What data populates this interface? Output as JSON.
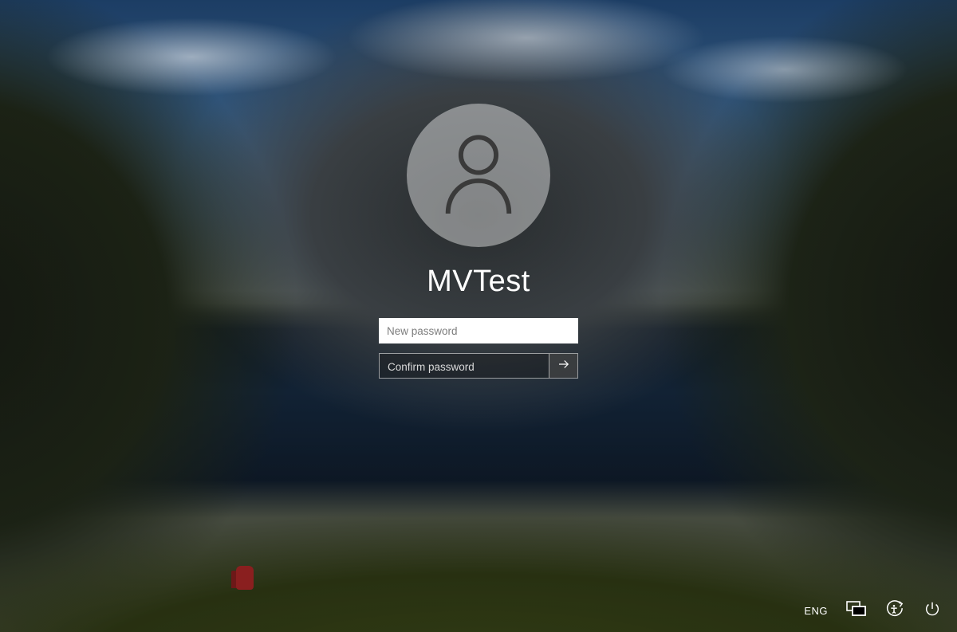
{
  "login": {
    "username": "MVTest",
    "new_password_placeholder": "New password",
    "new_password_value": "",
    "confirm_password_placeholder": "Confirm password",
    "confirm_password_value": ""
  },
  "tray": {
    "language": "ENG"
  }
}
